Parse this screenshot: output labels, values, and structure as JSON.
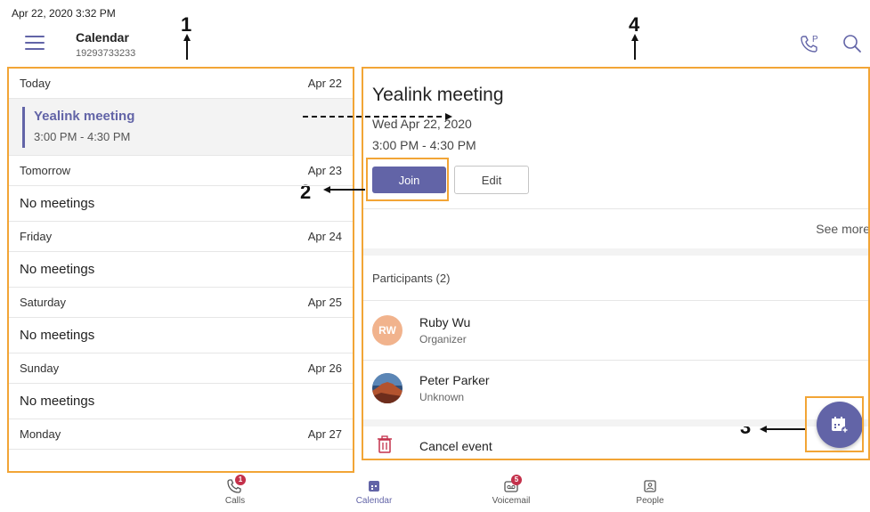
{
  "status_bar": {
    "datetime": "Apr 22, 2020  3:32 PM"
  },
  "header": {
    "title": "Calendar",
    "number": "19293733233"
  },
  "icons": {
    "menu": "hamburger-menu-icon",
    "park": "phone-park-icon",
    "search": "search-icon",
    "trash": "trash-icon",
    "new_meeting": "calendar-add-icon"
  },
  "callouts": {
    "n1": "1",
    "n2": "2",
    "n3": "3",
    "n4": "4"
  },
  "days": [
    {
      "day": "Today",
      "date": "Apr 22",
      "meeting": {
        "title": "Yealink meeting",
        "time": "3:00 PM - 4:30 PM"
      }
    },
    {
      "day": "Tomorrow",
      "date": "Apr 23",
      "empty_text": "No meetings"
    },
    {
      "day": "Friday",
      "date": "Apr 24",
      "empty_text": "No meetings"
    },
    {
      "day": "Saturday",
      "date": "Apr 25",
      "empty_text": "No meetings"
    },
    {
      "day": "Sunday",
      "date": "Apr 26",
      "empty_text": "No meetings"
    },
    {
      "day": "Monday",
      "date": "Apr 27"
    }
  ],
  "detail": {
    "title": "Yealink meeting",
    "date": "Wed Apr 22, 2020",
    "time": "3:00 PM - 4:30 PM",
    "join_label": "Join",
    "edit_label": "Edit",
    "see_more": "See more",
    "participants_label": "Participants (2)",
    "participants": [
      {
        "initials": "RW",
        "name": "Ruby Wu",
        "role": "Organizer"
      },
      {
        "name": "Peter Parker",
        "role": "Unknown"
      }
    ],
    "cancel_label": "Cancel event"
  },
  "nav": [
    {
      "label": "Calls",
      "icon": "calls-icon",
      "badge": "1"
    },
    {
      "label": "Calendar",
      "icon": "calendar-icon",
      "active": true
    },
    {
      "label": "Voicemail",
      "icon": "voicemail-icon",
      "badge": "5"
    },
    {
      "label": "People",
      "icon": "people-icon"
    }
  ],
  "colors": {
    "accent": "#6264a7",
    "highlight_box": "#f2a536",
    "badge": "#c4314b",
    "avatar_rw": "#f1b38d"
  }
}
